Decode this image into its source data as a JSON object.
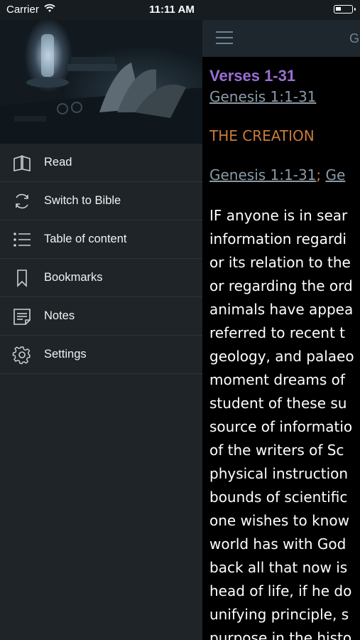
{
  "status_bar": {
    "carrier": "Carrier",
    "time": "11:11 AM"
  },
  "menu": [
    {
      "label": "Read",
      "icon": "book-icon"
    },
    {
      "label": "Switch to Bible",
      "icon": "refresh-icon"
    },
    {
      "label": "Table of content",
      "icon": "list-icon"
    },
    {
      "label": "Bookmarks",
      "icon": "bookmark-icon"
    },
    {
      "label": "Notes",
      "icon": "notes-icon"
    },
    {
      "label": "Settings",
      "icon": "gear-icon"
    }
  ],
  "navbar": {
    "title": "G"
  },
  "content": {
    "heading": "Verses 1-31",
    "reference": "Genesis 1:1-31",
    "section_title": "THE CREATION",
    "ref_line": {
      "link1": "Genesis 1:1-31",
      "separator": "; ",
      "link2": "Ge"
    },
    "lines": [
      "IF anyone is in sear",
      "information regardi",
      "or its relation to the",
      "or regarding the ord",
      "animals have appea",
      "referred to recent t",
      "geology, and palaeo",
      "moment dreams of",
      "student of these su",
      "source of informatio",
      "of the writers of Sc",
      "physical instruction",
      "bounds of scientific",
      "one wishes to know",
      "world has with God",
      "back all that now is",
      "head of life, if he do",
      "unifying principle, s",
      "purpose in the histo"
    ]
  }
}
